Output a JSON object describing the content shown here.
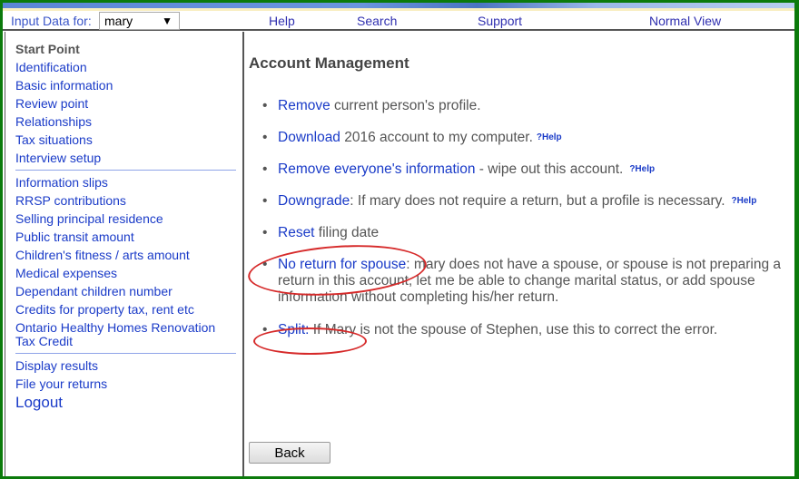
{
  "header": {
    "input_label": "Input Data for:",
    "person_select": {
      "value": "mary",
      "arrow_icon": "▼"
    },
    "nav": [
      {
        "label": "Help"
      },
      {
        "label": "Search"
      },
      {
        "label": "Support"
      },
      {
        "label": "Normal View"
      }
    ]
  },
  "sidebar": {
    "heading": "Start Point",
    "group1": [
      "Identification",
      "Basic information",
      "Review point",
      "Relationships",
      "Tax situations",
      "Interview setup"
    ],
    "group2": [
      "Information slips",
      "RRSP contributions",
      "Selling principal residence",
      "Public transit amount",
      "Children's fitness / arts amount",
      "Medical expenses",
      "Dependant children number",
      "Credits for property tax, rent etc",
      "Ontario Healthy Homes Renovation Tax Credit"
    ],
    "group3": [
      "Display results",
      "File your returns"
    ],
    "logout": "Logout"
  },
  "main": {
    "title": "Account Management",
    "items": [
      {
        "link": "Remove",
        "text": " current person's profile.",
        "help": ""
      },
      {
        "link": "Download",
        "text": " 2016 account to my computer.",
        "help": "?Help"
      },
      {
        "link": "Remove everyone's information",
        "text": " - wipe out this account.",
        "help": "?Help"
      },
      {
        "link": "Downgrade",
        "text": ": If mary does not require a return, but a profile is necessary.",
        "help": "?Help"
      },
      {
        "link": "Reset",
        "text": " filing date",
        "help": ""
      },
      {
        "link": "No return for spouse",
        "text": ": mary does not have a spouse, or spouse is not preparing a return in this account, let me be able to change marital status, or add spouse information without completing his/her return.",
        "help": ""
      },
      {
        "link": "Split:",
        "text": " If Mary is not the spouse of Stephen, use this to correct the error.",
        "help": ""
      }
    ],
    "back_label": "Back",
    "annotation_color": "#d62a2a"
  }
}
